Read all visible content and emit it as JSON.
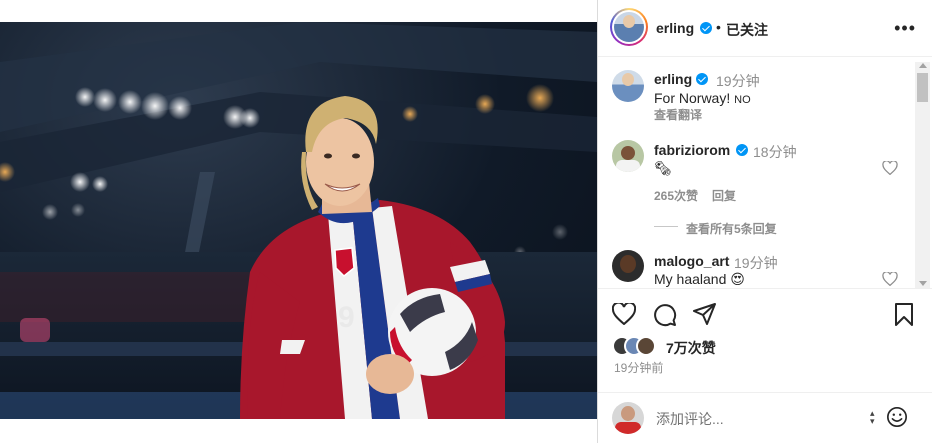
{
  "post": {
    "author": "erling",
    "follow_state": "已关注",
    "dot": "•",
    "more_label": "•••"
  },
  "caption": {
    "username": "erling",
    "time": "19分钟",
    "text": "For Norway! ",
    "flag_code": "NO",
    "translate_label": "查看翻译"
  },
  "comments": [
    {
      "username": "fabriziorom",
      "time": "18分钟",
      "text": "🗞",
      "likes": "265次赞",
      "reply_label": "回复",
      "view_replies": "查看所有5条回复"
    },
    {
      "username": "malogo_art",
      "time": "19分钟",
      "text": "My haaland ",
      "emoji": "😍"
    }
  ],
  "engagement": {
    "likes": "7万次赞",
    "time_ago": "19分钟前"
  },
  "composer": {
    "placeholder": "添加评论..."
  },
  "colors": {
    "verified": "#0095f6",
    "jersey_red": "#b4122a",
    "jersey_blue": "#1e3a8f"
  },
  "icons": {
    "like": "heart-icon",
    "comment": "comment-icon",
    "share": "paper-plane-icon",
    "save": "bookmark-icon",
    "emoji": "smiley-icon"
  }
}
